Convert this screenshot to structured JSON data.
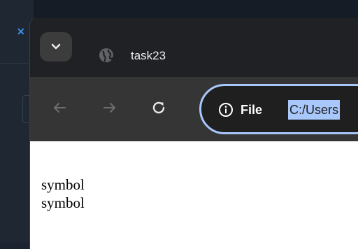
{
  "browser": {
    "tab": {
      "title": "task23",
      "favicon": "globe-icon"
    },
    "tab_search_icon": "chevron-down-icon",
    "nav": {
      "back_icon": "arrow-left-icon",
      "forward_icon": "arrow-right-icon",
      "reload_icon": "reload-icon"
    },
    "omnibox": {
      "scheme_label": "File",
      "url": "C:/Users",
      "info_icon": "info-icon"
    },
    "accent": "#a8c7fa"
  },
  "page": {
    "lines": [
      "symbol",
      "symbol"
    ]
  }
}
